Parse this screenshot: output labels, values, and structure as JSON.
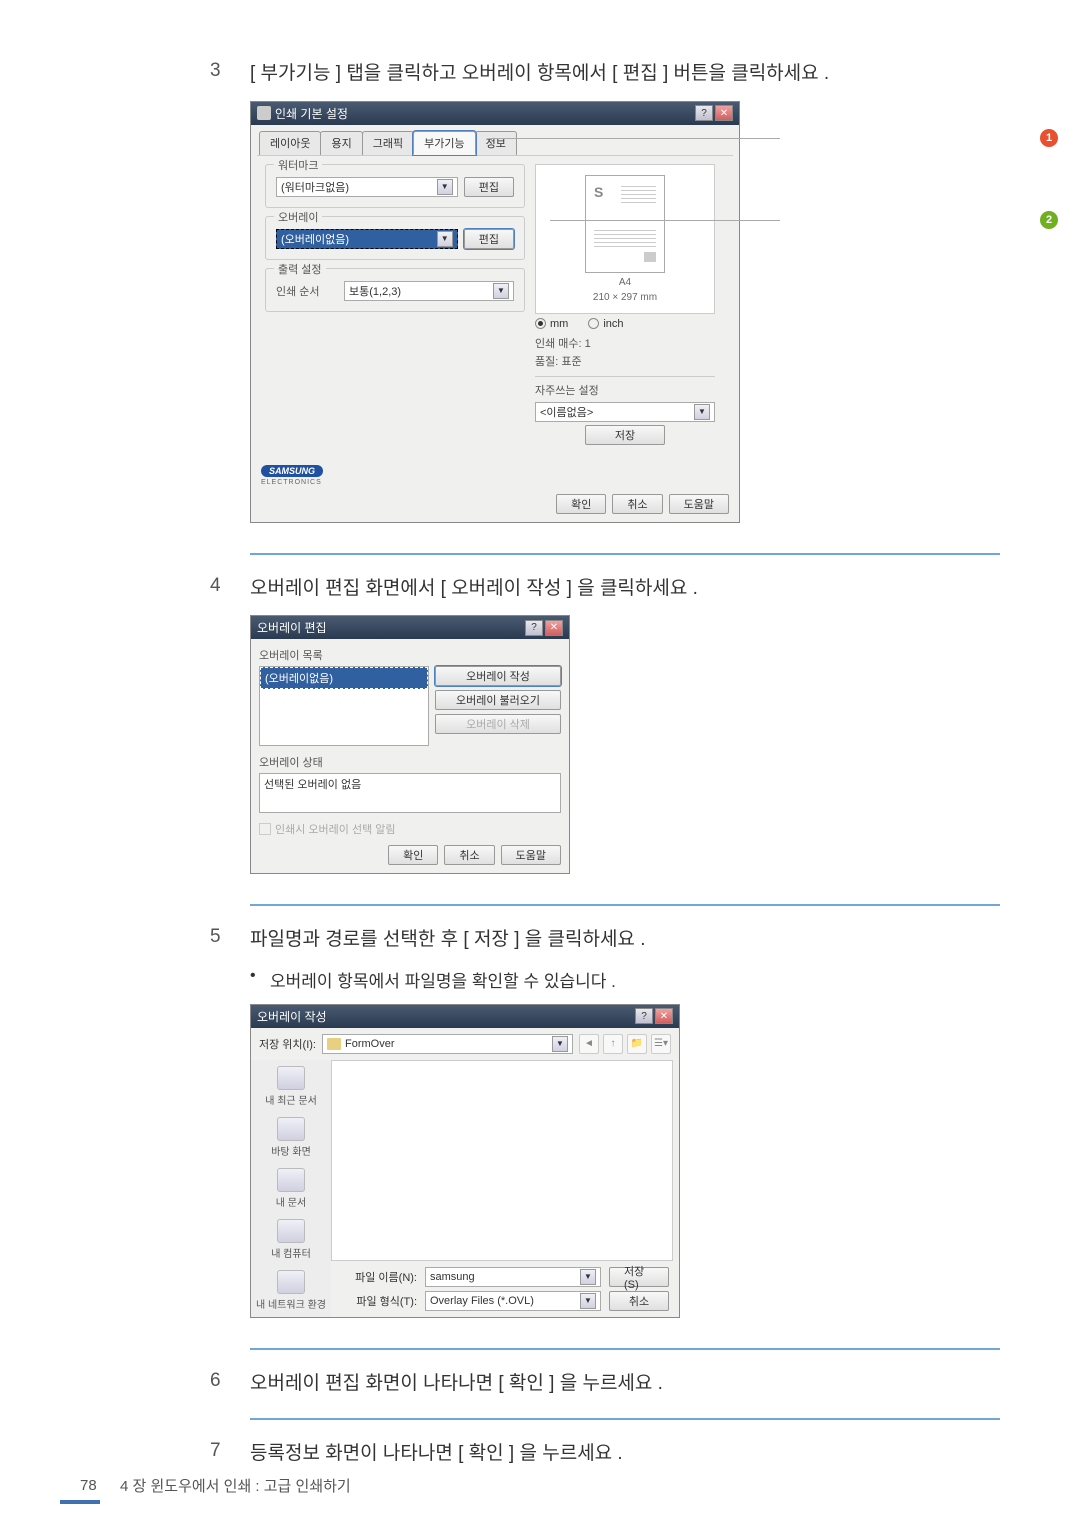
{
  "steps": {
    "s3": {
      "num": "3",
      "text": "[ 부가기능 ] 탭을 클릭하고 오버레이 항목에서 [ 편집 ] 버튼을 클릭하세요 ."
    },
    "s4": {
      "num": "4",
      "text": "오버레이 편집 화면에서 [ 오버레이 작성 ] 을 클릭하세요 ."
    },
    "s5": {
      "num": "5",
      "text": "파일명과 경로를 선택한 후 [ 저장 ] 을 클릭하세요 ."
    },
    "s5_sub": "오버레이 항목에서 파일명을 확인할 수 있습니다 .",
    "s6": {
      "num": "6",
      "text": "오버레이 편집 화면이 나타나면 [ 확인 ] 을 누르세요 ."
    },
    "s7": {
      "num": "7",
      "text": "등록정보 화면이 나타나면 [ 확인 ] 을 누르세요 ."
    }
  },
  "dialog1": {
    "title": "인쇄 기본 설정",
    "tabs": [
      "레이아웃",
      "용지",
      "그래픽",
      "부가기능",
      "정보"
    ],
    "watermark_group": "워터마크",
    "watermark_value": "(워터마크없음)",
    "overlay_group": "오버레이",
    "overlay_value": "(오버레이없음)",
    "edit_btn": "편집",
    "output_group": "출력 설정",
    "print_order_label": "인쇄 순서",
    "print_order_value": "보통(1,2,3)",
    "paper_size": "A4",
    "paper_dim": "210 × 297 mm",
    "unit_mm": "mm",
    "unit_inch": "inch",
    "copies": "인쇄 매수: 1",
    "quality": "품질: 표준",
    "favorites_label": "자주쓰는 설정",
    "favorites_value": "<이름없음>",
    "save_btn": "저장",
    "logo": "SAMSUNG",
    "logo_sub": "ELECTRONICS",
    "ok": "확인",
    "cancel": "취소",
    "help": "도움말",
    "callout1": "1",
    "callout2": "2"
  },
  "dialog2": {
    "title": "오버레이 편집",
    "list_label": "오버레이 목록",
    "list_item": "(오버레이없음)",
    "btn_create": "오버레이 작성",
    "btn_load": "오버레이 불러오기",
    "btn_delete": "오버레이 삭제",
    "status_label": "오버레이 상태",
    "status_text": "선택된 오버레이 없음",
    "checkbox": "인쇄시 오버레이 선택 알림",
    "ok": "확인",
    "cancel": "취소",
    "help": "도움말"
  },
  "dialog3": {
    "title": "오버레이 작성",
    "save_in_label": "저장 위치(I):",
    "save_in_value": "FormOver",
    "sidebar": [
      "내 최근 문서",
      "바탕 화면",
      "내 문서",
      "내 컴퓨터",
      "내 네트워크 환경"
    ],
    "filename_label": "파일 이름(N):",
    "filename_value": "samsung",
    "filetype_label": "파일 형식(T):",
    "filetype_value": "Overlay Files (*.OVL)",
    "save_btn": "저장(S)",
    "cancel_btn": "취소"
  },
  "footer": {
    "page": "78",
    "text": "4 장   윈도우에서 인쇄 : 고급 인쇄하기"
  }
}
